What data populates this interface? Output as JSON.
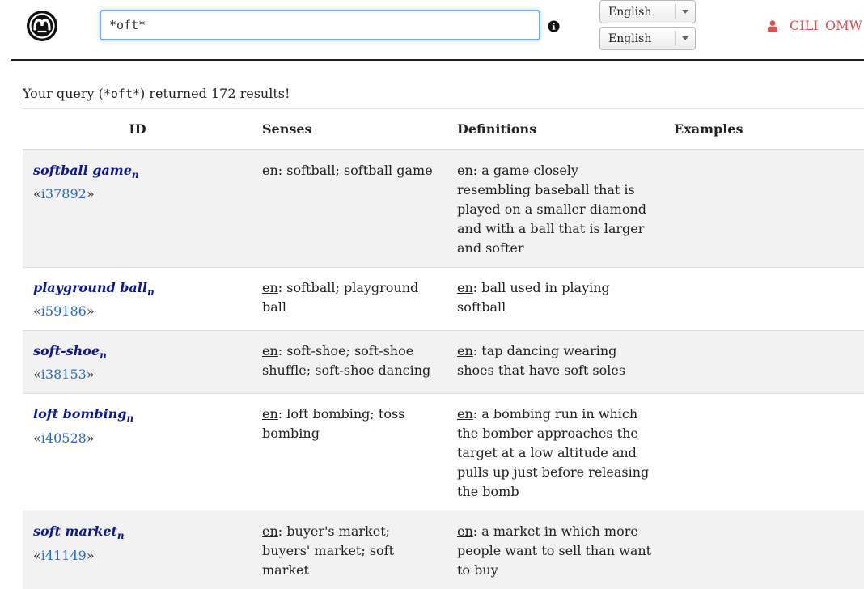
{
  "header": {
    "search": {
      "value": "*oft*",
      "placeholder": ""
    },
    "lang_selects": [
      "English",
      "English"
    ],
    "nav": {
      "cili": "CILI",
      "omw": "OMW"
    }
  },
  "query_summary": {
    "prefix": "Your query (",
    "query": "*oft*",
    "suffix": ") returned 172 results!"
  },
  "table": {
    "headers": {
      "id": "ID",
      "senses": "Senses",
      "definitions": "Definitions",
      "examples": "Examples"
    },
    "rows": [
      {
        "lemma": "softball game",
        "pos": "n",
        "ili": "i37892",
        "senses_lang": "en",
        "senses": "softball; softball game",
        "def_lang": "en",
        "definition": "a game closely resembling baseball that is played on a smaller diamond and with a ball that is larger and softer",
        "examples": ""
      },
      {
        "lemma": "playground ball",
        "pos": "n",
        "ili": "i59186",
        "senses_lang": "en",
        "senses": "softball; playground ball",
        "def_lang": "en",
        "definition": "ball used in playing softball",
        "examples": ""
      },
      {
        "lemma": "soft-shoe",
        "pos": "n",
        "ili": "i38153",
        "senses_lang": "en",
        "senses": "soft-shoe; soft-shoe shuffle; soft-shoe dancing",
        "def_lang": "en",
        "definition": "tap dancing wearing shoes that have soft soles",
        "examples": ""
      },
      {
        "lemma": "loft bombing",
        "pos": "n",
        "ili": "i40528",
        "senses_lang": "en",
        "senses": "loft bombing; toss bombing",
        "def_lang": "en",
        "definition": "a bombing run in which the bomber approaches the target at a low altitude and pulls up just before releasing the bomb",
        "examples": ""
      },
      {
        "lemma": "soft market",
        "pos": "n",
        "ili": "i41149",
        "senses_lang": "en",
        "senses": "buyer's market; buyers' market; soft market",
        "def_lang": "en",
        "definition": "a market in which more people want to sell than want to buy",
        "examples": ""
      }
    ]
  },
  "colors": {
    "nav_link": "#d9534f",
    "lemma": "#0d1a8c",
    "ili_link": "#2a6cc0",
    "stripe": "#f2f2f2"
  }
}
